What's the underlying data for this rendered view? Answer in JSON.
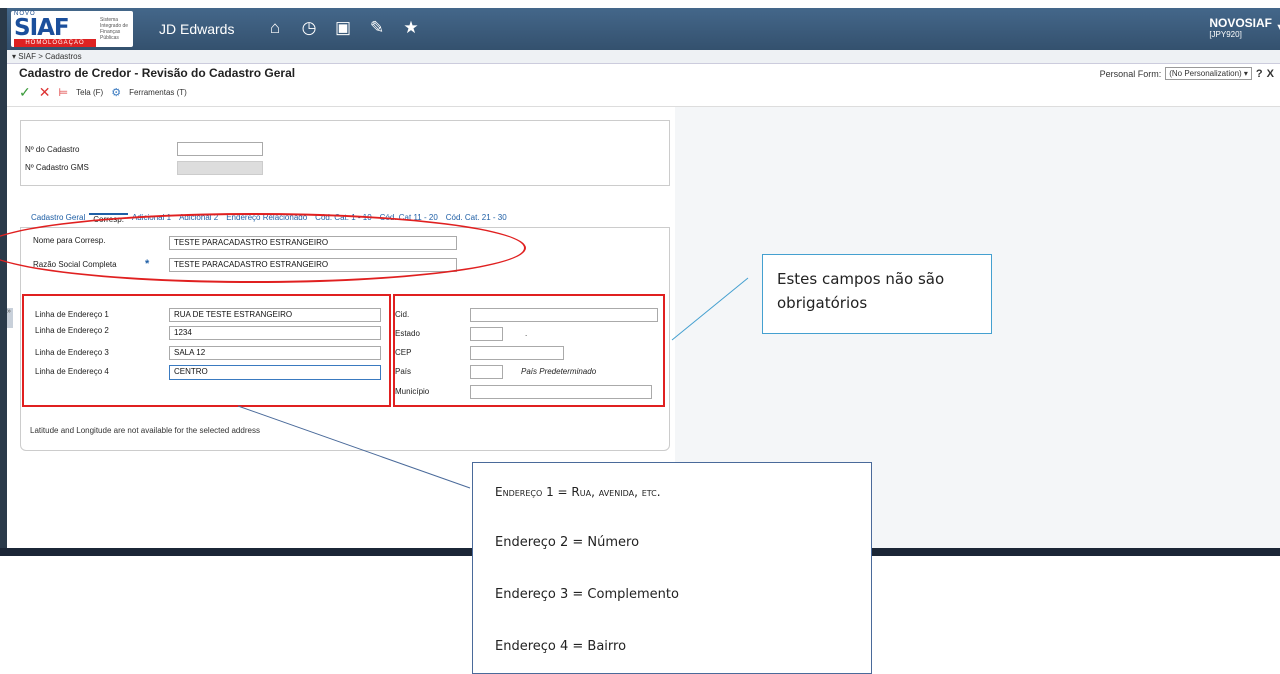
{
  "logo": {
    "top_word": "NOVO",
    "brand": "SIAF",
    "subtitle": "Sistema Integrado de Finanças Públicas",
    "env_badge": "HOMOLOGAÇÃO"
  },
  "topbar": {
    "app_name": "JD Edwards",
    "icons": [
      "home-icon",
      "recent-icon",
      "dashboard-icon",
      "edit-icon",
      "favorites-icon"
    ],
    "user": "NOVOSIAF",
    "env": "[JPY920]"
  },
  "breadcrumb": "▾ SIAF > Cadastros",
  "form": {
    "title": "Cadastro de Credor - Revisão do Cadastro Geral",
    "personal_form_label": "Personal Form:",
    "personal_form_value": "(No Personalization) ▾",
    "help": "?",
    "close": "X",
    "toolbar": {
      "tela": "Tela (F)",
      "ferramentas": "Ferramentas (T)"
    }
  },
  "header_fields": {
    "cadastro_label": "Nº do Cadastro",
    "cadastro_value": "",
    "gms_label": "Nº Cadastro GMS"
  },
  "tabs": [
    "Cadastro Geral",
    "Corresp.",
    "Adicional 1",
    "Adicional 2",
    "Endereço Relacionado",
    "Cód. Cat. 1 - 10",
    "Cód. Cat 11 - 20",
    "Cód. Cat. 21 - 30"
  ],
  "corresp": {
    "nome_label": "Nome para Corresp.",
    "nome_value": "TESTE PARACADASTRO ESTRANGEIRO",
    "razao_label": "Razão Social Completa",
    "razao_value": "TESTE PARACADASTRO ESTRANGEIRO",
    "required_mark": "*"
  },
  "address": {
    "linha1_label": "Linha de Endereço 1",
    "linha1_value": "RUA DE TESTE ESTRANGEIRO",
    "linha2_label": "Linha de Endereço 2",
    "linha2_value": "1234",
    "linha3_label": "Linha de Endereço 3",
    "linha3_value": "SALA 12",
    "linha4_label": "Linha de Endereço 4",
    "linha4_value": "CENTRO"
  },
  "location": {
    "cid_label": "Cid.",
    "estado_label": "Estado",
    "estado_suffix": ".",
    "cep_label": "CEP",
    "pais_label": "País",
    "pais_default": "País Predeterminado",
    "municipio_label": "Município"
  },
  "latlong_note": "Latitude and Longitude are not available for the selected address",
  "callout_optional": "Estes campos não são obrigatórios",
  "callout_legend": {
    "l1_prefix": "E",
    "l1_sc": "ndereço",
    "l1_mid": " 1 = R",
    "l1_sc2": "ua, avenida, etc.",
    "l2": "Endereço 2 = Número",
    "l3": "Endereço 3 = Complemento",
    "l4": "Endereço 4 = Bairro"
  },
  "colors": {
    "topbar": "#3a5a78",
    "link": "#1f5fa6",
    "highlight": "#e02020",
    "callout_border": "#44a0d0"
  }
}
